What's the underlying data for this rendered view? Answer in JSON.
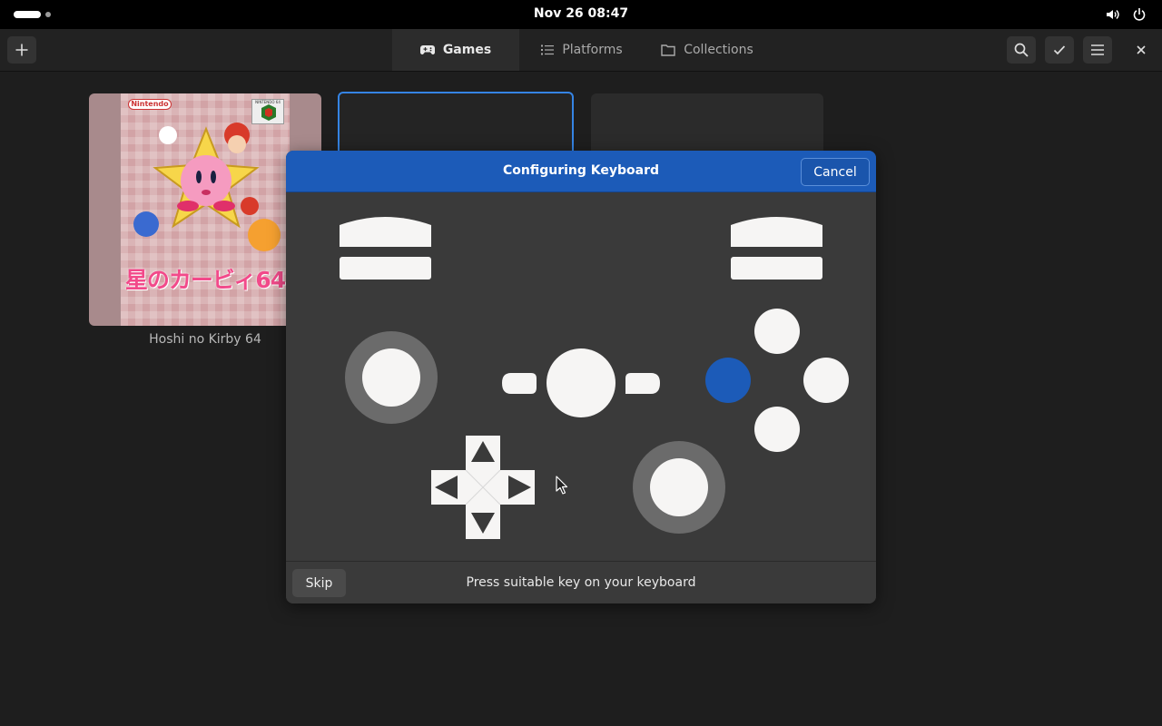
{
  "topbar": {
    "clock": "Nov 26  08:47",
    "icons": [
      "activities-pill",
      "workspace-dot",
      "volume-icon",
      "power-icon"
    ]
  },
  "header": {
    "add_icon": "plus-icon",
    "tabs": [
      {
        "label": "Games",
        "icon": "gamepad-icon",
        "active": true
      },
      {
        "label": "Platforms",
        "icon": "list-icon",
        "active": false
      },
      {
        "label": "Collections",
        "icon": "folder-icon",
        "active": false
      }
    ],
    "right_icons": [
      "search-icon",
      "check-icon",
      "menu-icon",
      "close-icon"
    ]
  },
  "library": {
    "games": [
      {
        "title": "Hoshi no Kirby 64",
        "cover_text": "星のカービィ64",
        "publisher": "Nintendo",
        "platform": "NINTENDO 64"
      },
      {
        "title": "",
        "selected": true
      },
      {
        "title": ""
      }
    ]
  },
  "dialog": {
    "title": "Configuring Keyboard",
    "cancel_label": "Cancel",
    "skip_label": "Skip",
    "hint": "Press suitable key on your keyboard",
    "highlighted_button": "west-face-button",
    "accent_color": "#1c5bb8"
  }
}
